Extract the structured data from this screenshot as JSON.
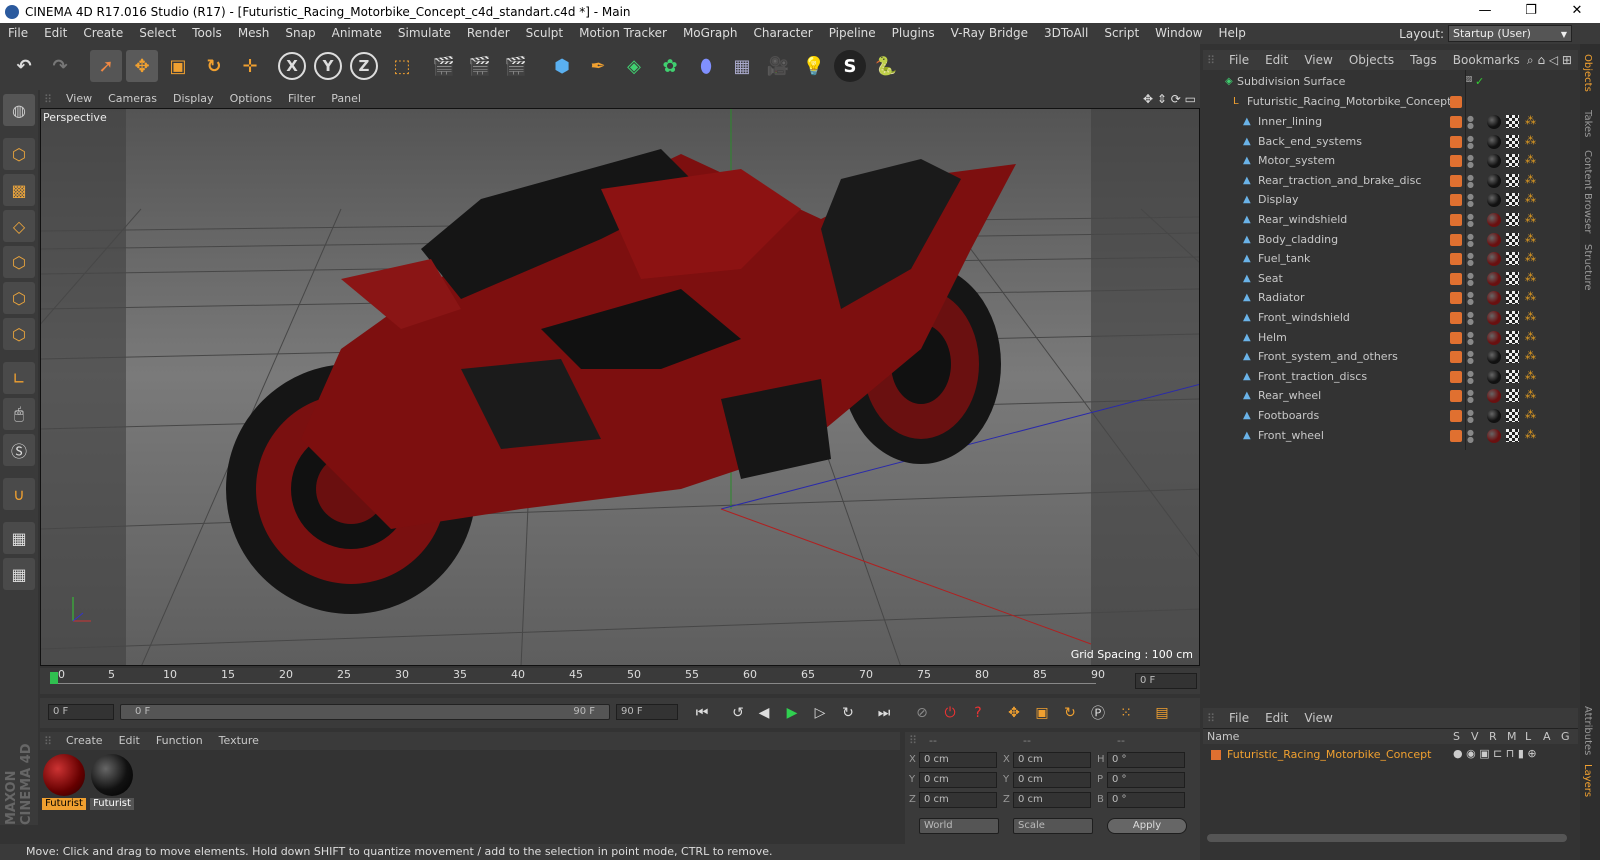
{
  "window": {
    "title": "CINEMA 4D R17.016 Studio (R17) - [Futuristic_Racing_Motorbike_Concept_c4d_standart.c4d *] - Main",
    "minimize": "—",
    "maximize": "❐",
    "close": "✕"
  },
  "menubar": {
    "items": [
      "File",
      "Edit",
      "Create",
      "Select",
      "Tools",
      "Mesh",
      "Snap",
      "Animate",
      "Simulate",
      "Render",
      "Sculpt",
      "Motion Tracker",
      "MoGraph",
      "Character",
      "Pipeline",
      "Plugins",
      "V-Ray Bridge",
      "3DToAll",
      "Script",
      "Window",
      "Help"
    ],
    "layout_label": "Layout:",
    "layout_value": "Startup (User)"
  },
  "toolbar": {
    "x_label": "X",
    "y_label": "Y",
    "z_label": "Z"
  },
  "viewport": {
    "menu": [
      "View",
      "Cameras",
      "Display",
      "Options",
      "Filter",
      "Panel"
    ],
    "camera_label": "Perspective",
    "grid_spacing": "Grid Spacing : 100 cm"
  },
  "timeline": {
    "ticks": [
      "0",
      "5",
      "10",
      "15",
      "20",
      "25",
      "30",
      "35",
      "40",
      "45",
      "50",
      "55",
      "60",
      "65",
      "70",
      "75",
      "80",
      "85",
      "90"
    ],
    "current_frame_field": "0 F",
    "start_field": "0 F",
    "range_start": "0 F",
    "range_end": "90 F",
    "end_field": "90 F"
  },
  "material_manager": {
    "menu": [
      "Create",
      "Edit",
      "Function",
      "Texture"
    ],
    "materials": [
      {
        "name": "Futurist",
        "selected": true
      },
      {
        "name": "Futurist",
        "selected": false
      }
    ]
  },
  "coordinates": {
    "header": [
      "--",
      "--",
      "--"
    ],
    "rows": [
      {
        "l1": "X",
        "v1": "0 cm",
        "l2": "X",
        "v2": "0 cm",
        "l3": "H",
        "v3": "0 °"
      },
      {
        "l1": "Y",
        "v1": "0 cm",
        "l2": "Y",
        "v2": "0 cm",
        "l3": "P",
        "v3": "0 °"
      },
      {
        "l1": "Z",
        "v1": "0 cm",
        "l2": "Z",
        "v2": "0 cm",
        "l3": "B",
        "v3": "0 °"
      }
    ],
    "mode1": "World",
    "mode2": "Scale",
    "apply": "Apply"
  },
  "status": "Move: Click and drag to move elements. Hold down SHIFT to quantize movement / add to the selection in point mode, CTRL to remove.",
  "object_manager": {
    "menu": [
      "File",
      "Edit",
      "View",
      "Objects",
      "Tags",
      "Bookmarks"
    ],
    "root": "Subdivision Surface",
    "group": "Futuristic_Racing_Motorbike_Concept",
    "children": [
      "Inner_lining",
      "Back_end_systems",
      "Motor_system",
      "Rear_traction_and_brake_disc",
      "Display",
      "Rear_windshield",
      "Body_cladding",
      "Fuel_tank",
      "Seat",
      "Radiator",
      "Front_windshield",
      "Helm",
      "Front_system_and_others",
      "Front_traction_discs",
      "Rear_wheel",
      "Footboards",
      "Front_wheel"
    ],
    "ball_colors": [
      "#111",
      "#111",
      "#111",
      "#111",
      "#111",
      "#6a1010",
      "#6a1010",
      "#6a1010",
      "#6a1010",
      "#6a1010",
      "#6a1010",
      "#6a1010",
      "#111",
      "#111",
      "#6a1010",
      "#111",
      "#6a1010"
    ]
  },
  "layer_manager": {
    "menu": [
      "File",
      "Edit",
      "View"
    ],
    "columns": [
      "Name",
      "S",
      "V",
      "R",
      "M",
      "L",
      "A",
      "G"
    ],
    "layer": "Futuristic_Racing_Motorbike_Concept"
  },
  "side_tabs": [
    "Objects",
    "Takes",
    "Content Browser",
    "Structure"
  ],
  "side_tabs_bottom": [
    "Attributes",
    "Layers"
  ],
  "brand": "MAXON CINEMA 4D"
}
